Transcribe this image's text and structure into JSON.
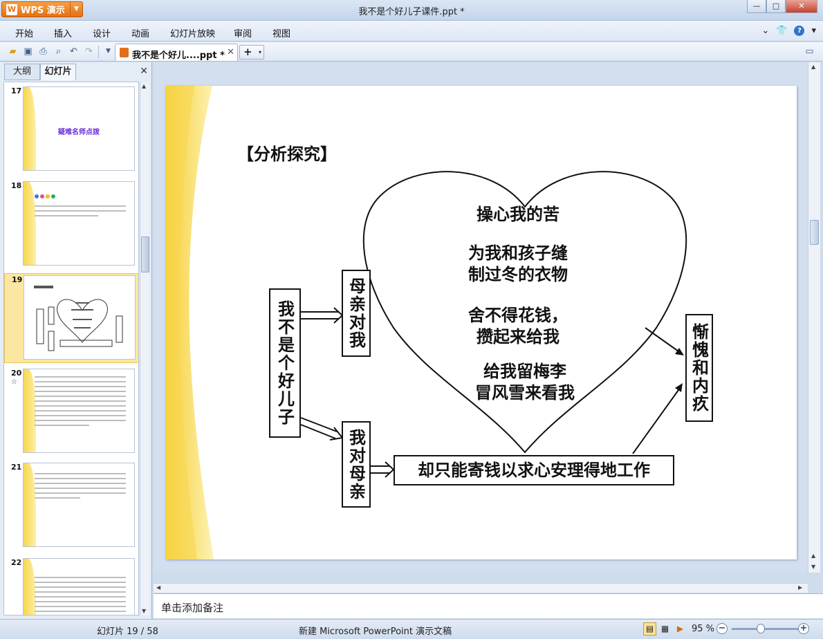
{
  "app": {
    "brand_label": "WPS 演示",
    "brand_logo": "W",
    "window_title": "我不是个好儿子课件.ppt *",
    "controls": {
      "minimize": "—",
      "maximize": "□",
      "close": "✕"
    }
  },
  "menu": {
    "items": [
      "开始",
      "插入",
      "设计",
      "动画",
      "幻灯片放映",
      "审阅",
      "视图"
    ]
  },
  "toolbar": {
    "doc_tab_label": "我不是个好儿....ppt *",
    "doc_tab_close": "✕",
    "new_tab": "+",
    "new_tab_dropdown": "▾"
  },
  "left_pane": {
    "tabs": [
      "大纲",
      "幻灯片"
    ],
    "active_tab": "幻灯片",
    "close": "✕",
    "thumbnails": [
      {
        "number": "17",
        "title": "疑难名师点拨"
      },
      {
        "number": "18"
      },
      {
        "number": "19",
        "selected": true
      },
      {
        "number": "20",
        "sub": "☆"
      },
      {
        "number": "21"
      },
      {
        "number": "22"
      }
    ]
  },
  "slide": {
    "title": "【分析探究】",
    "left_box": "我不是个好儿子",
    "mother_to_me": "母亲对我",
    "me_to_mother": "我对母亲",
    "heart_lines": [
      "操心我的苦",
      "为我和孩子缝",
      "制过冬的衣物",
      "舍不得花钱，",
      "攒起来给我",
      "给我留梅李",
      "冒风雪来看我"
    ],
    "bottom_box": "却只能寄钱以求心安理得地工作",
    "right_box": "惭愧和内疚"
  },
  "notes": {
    "placeholder": "单击添加备注"
  },
  "status": {
    "slide_info": "幻灯片 19 / 58",
    "template": "新建 Microsoft PowerPoint 演示文稿",
    "zoom": "95 %",
    "zoom_out": "−",
    "zoom_in": "+"
  },
  "colors": {
    "accent_orange": "#e9700f",
    "selection": "#fbe7a2",
    "slide_wave": "#f7d64e"
  }
}
